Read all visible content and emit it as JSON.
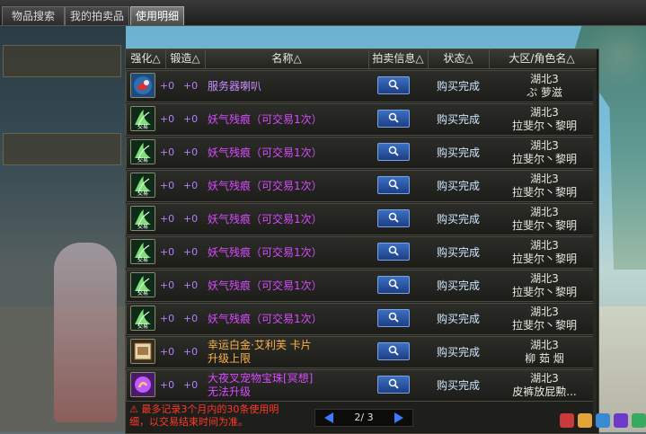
{
  "tabs": [
    {
      "label": "物品搜索"
    },
    {
      "label": "我的拍卖品"
    },
    {
      "label": "使用明细"
    }
  ],
  "columns": {
    "enhance": "强化△",
    "forge": "锻造△",
    "name": "名称△",
    "auction_info": "拍卖信息△",
    "status": "状态△",
    "server": "大区/角色名△"
  },
  "rows": [
    {
      "icon": "horn-icon",
      "enhance": "+0",
      "forge": "+0",
      "name_line1": "服务器喇叭",
      "name_line2": "",
      "name_color": "#c98cff",
      "status": "购买完成",
      "region": "湖北3",
      "character": "ぷ 萝滋"
    },
    {
      "icon": "tradable-item-icon",
      "enhance": "+0",
      "forge": "+0",
      "name_line1": "妖气残痕（可交易1次）",
      "name_line2": "",
      "name_color": "#d84bff",
      "status": "购买完成",
      "region": "湖北3",
      "character": "拉斐尔丶黎明"
    },
    {
      "icon": "tradable-item-icon",
      "enhance": "+0",
      "forge": "+0",
      "name_line1": "妖气残痕（可交易1次）",
      "name_line2": "",
      "name_color": "#d84bff",
      "status": "购买完成",
      "region": "湖北3",
      "character": "拉斐尔丶黎明"
    },
    {
      "icon": "tradable-item-icon",
      "enhance": "+0",
      "forge": "+0",
      "name_line1": "妖气残痕（可交易1次）",
      "name_line2": "",
      "name_color": "#d84bff",
      "status": "购买完成",
      "region": "湖北3",
      "character": "拉斐尔丶黎明"
    },
    {
      "icon": "tradable-item-icon",
      "enhance": "+0",
      "forge": "+0",
      "name_line1": "妖气残痕（可交易1次）",
      "name_line2": "",
      "name_color": "#d84bff",
      "status": "购买完成",
      "region": "湖北3",
      "character": "拉斐尔丶黎明"
    },
    {
      "icon": "tradable-item-icon",
      "enhance": "+0",
      "forge": "+0",
      "name_line1": "妖气残痕（可交易1次）",
      "name_line2": "",
      "name_color": "#d84bff",
      "status": "购买完成",
      "region": "湖北3",
      "character": "拉斐尔丶黎明"
    },
    {
      "icon": "tradable-item-icon",
      "enhance": "+0",
      "forge": "+0",
      "name_line1": "妖气残痕（可交易1次）",
      "name_line2": "",
      "name_color": "#d84bff",
      "status": "购买完成",
      "region": "湖北3",
      "character": "拉斐尔丶黎明"
    },
    {
      "icon": "tradable-item-icon",
      "enhance": "+0",
      "forge": "+0",
      "name_line1": "妖气残痕（可交易1次）",
      "name_line2": "",
      "name_color": "#d84bff",
      "status": "购买完成",
      "region": "湖北3",
      "character": "拉斐尔丶黎明"
    },
    {
      "icon": "card-icon",
      "enhance": "+0",
      "forge": "+0",
      "name_line1": "幸运白金·艾利芙 卡片",
      "name_line2": "升级上限",
      "name_color": "#ffb24a",
      "status": "购买完成",
      "region": "湖北3",
      "character": "柳 茹 烟"
    },
    {
      "icon": "orb-icon",
      "enhance": "+0",
      "forge": "+0",
      "name_line1": "大夜叉宠物宝珠[冥想]",
      "name_line2": "无法升级",
      "name_color": "#d84bff",
      "status": "购买完成",
      "region": "湖北3",
      "character": "皮裤放屁勲..."
    }
  ],
  "footer": {
    "note": "最多记录3个月内的30条使用明细，以交易结束时间为准。",
    "page": "2/ 3"
  },
  "colors": {
    "enhance": "#b87cff",
    "status": "#cfe7ff",
    "warning": "#ff3a2a"
  }
}
